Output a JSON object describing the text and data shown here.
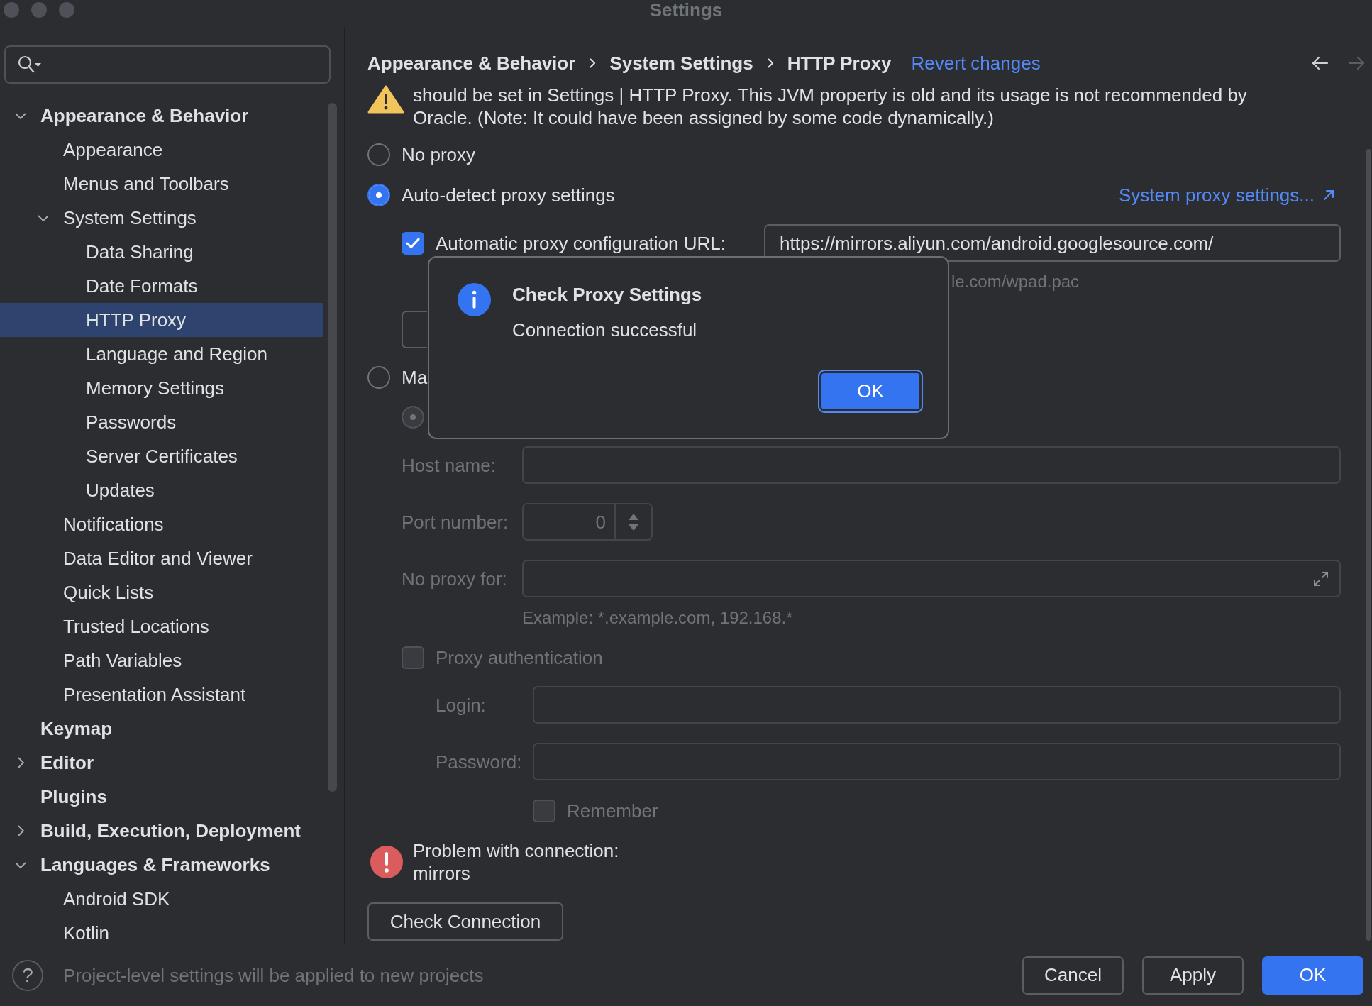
{
  "window": {
    "title": "Settings"
  },
  "sidebar": {
    "items": [
      {
        "label": "Appearance & Behavior",
        "expanded": true,
        "selected": false,
        "children": [
          {
            "label": "Appearance",
            "selected": false
          },
          {
            "label": "Menus and Toolbars",
            "selected": false
          },
          {
            "label": "System Settings",
            "expanded": true,
            "selected": false,
            "children": [
              {
                "label": "Data Sharing",
                "selected": false
              },
              {
                "label": "Date Formats",
                "selected": false
              },
              {
                "label": "HTTP Proxy",
                "selected": true
              },
              {
                "label": "Language and Region",
                "selected": false
              },
              {
                "label": "Memory Settings",
                "selected": false
              },
              {
                "label": "Passwords",
                "selected": false
              },
              {
                "label": "Server Certificates",
                "selected": false
              },
              {
                "label": "Updates",
                "selected": false
              }
            ]
          },
          {
            "label": "Notifications",
            "selected": false
          },
          {
            "label": "Data Editor and Viewer",
            "selected": false
          },
          {
            "label": "Quick Lists",
            "selected": false
          },
          {
            "label": "Trusted Locations",
            "selected": false
          },
          {
            "label": "Path Variables",
            "selected": false
          },
          {
            "label": "Presentation Assistant",
            "selected": false
          }
        ]
      },
      {
        "label": "Keymap",
        "selected": false
      },
      {
        "label": "Editor",
        "expanded": false,
        "selected": false
      },
      {
        "label": "Plugins",
        "selected": false
      },
      {
        "label": "Build, Execution, Deployment",
        "expanded": false,
        "selected": false
      },
      {
        "label": "Languages & Frameworks",
        "expanded": true,
        "selected": false,
        "children": [
          {
            "label": "Android SDK",
            "selected": false
          },
          {
            "label": "Kotlin",
            "selected": false
          }
        ]
      }
    ]
  },
  "breadcrumb": {
    "items": [
      "Appearance & Behavior",
      "System Settings",
      "HTTP Proxy"
    ],
    "revert_link": "Revert changes",
    "back": {
      "disabled": false
    },
    "forward": {
      "disabled": true
    }
  },
  "warning": {
    "lines": [
      "should be set in Settings | HTTP Proxy. This JVM property is old and its usage is not recommended by",
      "Oracle. (Note: It could have been assigned by some code dynamically.)"
    ]
  },
  "proxy_modes": [
    {
      "label": "No proxy",
      "selected": false
    },
    {
      "label": "Auto-detect proxy settings",
      "selected": true
    },
    {
      "label": "Ma",
      "selected": false
    }
  ],
  "system_proxy_link": "System proxy settings...",
  "auto_config": {
    "label": "Automatic proxy configuration URL:",
    "checked": true,
    "value": "https://mirrors.aliyun.com/android.googlesource.com/",
    "hint": "le.com/wpad.pac"
  },
  "manual": {
    "disabled": true,
    "protocol_radio": {
      "selected": true
    },
    "fields": [
      {
        "kind": "text",
        "label": "Host name:"
      },
      {
        "kind": "spinner",
        "label": "Port number:",
        "value": "0"
      },
      {
        "kind": "expandable",
        "label": "No proxy for:"
      }
    ],
    "example": "Example: *.example.com, 192.168.*"
  },
  "auth": {
    "label": "Proxy authentication",
    "checked": false,
    "disabled": true,
    "fields": [
      {
        "label": "Login:"
      },
      {
        "label": "Password:"
      }
    ],
    "remember": {
      "label": "Remember",
      "checked": false
    }
  },
  "problem": {
    "lines": [
      "Problem with connection:",
      "mirrors"
    ]
  },
  "check_button": "Check Connection",
  "dialog": {
    "title": "Check Proxy Settings",
    "message": "Connection successful",
    "button": "OK"
  },
  "footer": {
    "help": "?",
    "note": "Project-level settings will be applied to new projects",
    "buttons": [
      {
        "label": "Cancel",
        "kind": "secondary"
      },
      {
        "label": "Apply",
        "kind": "secondary"
      },
      {
        "label": "OK",
        "kind": "primary"
      }
    ]
  }
}
